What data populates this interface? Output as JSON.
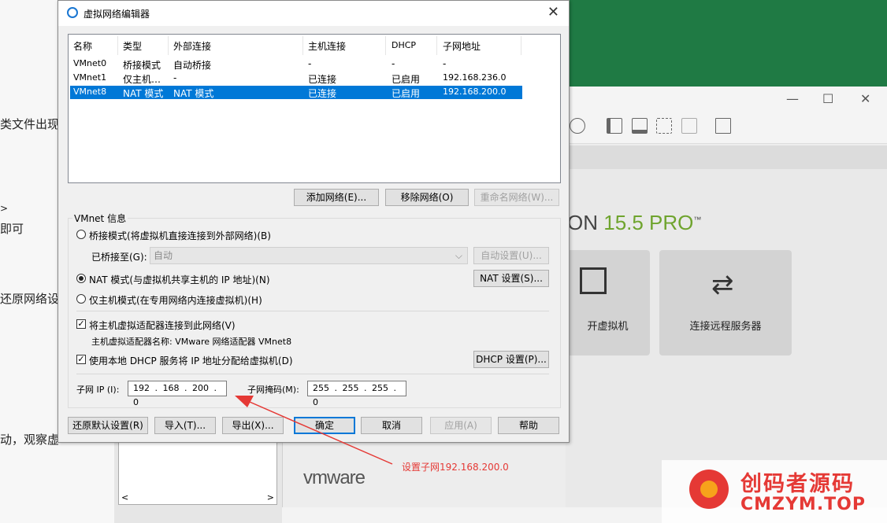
{
  "background_doc": {
    "lines": [
      "类文件出现",
      ">",
      "即可",
      "还原网络设",
      "动，观察虚"
    ]
  },
  "vmware": {
    "title_prefix": "ON",
    "version": "15.5 PRO",
    "tm": "™",
    "card_open": "开虚拟机",
    "card_remote": "连接远程服务器",
    "logo": "vmware",
    "win_min": "—",
    "win_max": "☐",
    "win_close": "✕",
    "scroll_left": "<",
    "scroll_right": ">"
  },
  "dialog": {
    "title": "虚拟网络编辑器",
    "close": "✕",
    "columns": [
      "名称",
      "类型",
      "外部连接",
      "主机连接",
      "DHCP",
      "子网地址"
    ],
    "rows": [
      {
        "name": "VMnet0",
        "type": "桥接模式",
        "external": "自动桥接",
        "host": "-",
        "dhcp": "-",
        "subnet": "-",
        "selected": false
      },
      {
        "name": "VMnet1",
        "type": "仅主机…",
        "external": "-",
        "host": "已连接",
        "dhcp": "已启用",
        "subnet": "192.168.236.0",
        "selected": false
      },
      {
        "name": "VMnet8",
        "type": "NAT 模式",
        "external": "NAT 模式",
        "host": "已连接",
        "dhcp": "已启用",
        "subnet": "192.168.200.0",
        "selected": true
      }
    ],
    "btn_add": "添加网络(E)...",
    "btn_remove": "移除网络(O)",
    "btn_rename": "重命名网络(W)...",
    "group_label": "VMnet 信息",
    "radio_bridge": "桥接模式(将虚拟机直接连接到外部网络)(B)",
    "bridge_to_label": "已桥接至(G):",
    "bridge_to_value": "自动",
    "btn_auto": "自动设置(U)...",
    "radio_nat": "NAT 模式(与虚拟机共享主机的 IP 地址)(N)",
    "btn_nat": "NAT 设置(S)...",
    "radio_host": "仅主机模式(在专用网络内连接虚拟机)(H)",
    "chk_connect": "将主机虚拟适配器连接到此网络(V)",
    "adapter_name": "主机虚拟适配器名称: VMware 网络适配器 VMnet8",
    "chk_dhcp": "使用本地 DHCP 服务将 IP 地址分配给虚拟机(D)",
    "btn_dhcp": "DHCP 设置(P)...",
    "subnet_ip_label": "子网 IP (I):",
    "subnet_ip": "192 . 168 . 200 . 0",
    "subnet_mask_label": "子网掩码(M):",
    "subnet_mask": "255 . 255 . 255 . 0",
    "btn_restore": "还原默认设置(R)",
    "btn_import": "导入(T)...",
    "btn_export": "导出(X)...",
    "btn_ok": "确定",
    "btn_cancel": "取消",
    "btn_apply": "应用(A)",
    "btn_help": "帮助",
    "check_mark": "✓"
  },
  "annotation": {
    "text": "设置子网192.168.200.0",
    "color": "#e53935"
  },
  "watermark": {
    "line1": "创码者源码",
    "line2": "CMZYM.TOP"
  },
  "colors": {
    "selection": "#0078d7",
    "green_banner": "#1f7a44",
    "pro_accent": "#6fa42e"
  }
}
